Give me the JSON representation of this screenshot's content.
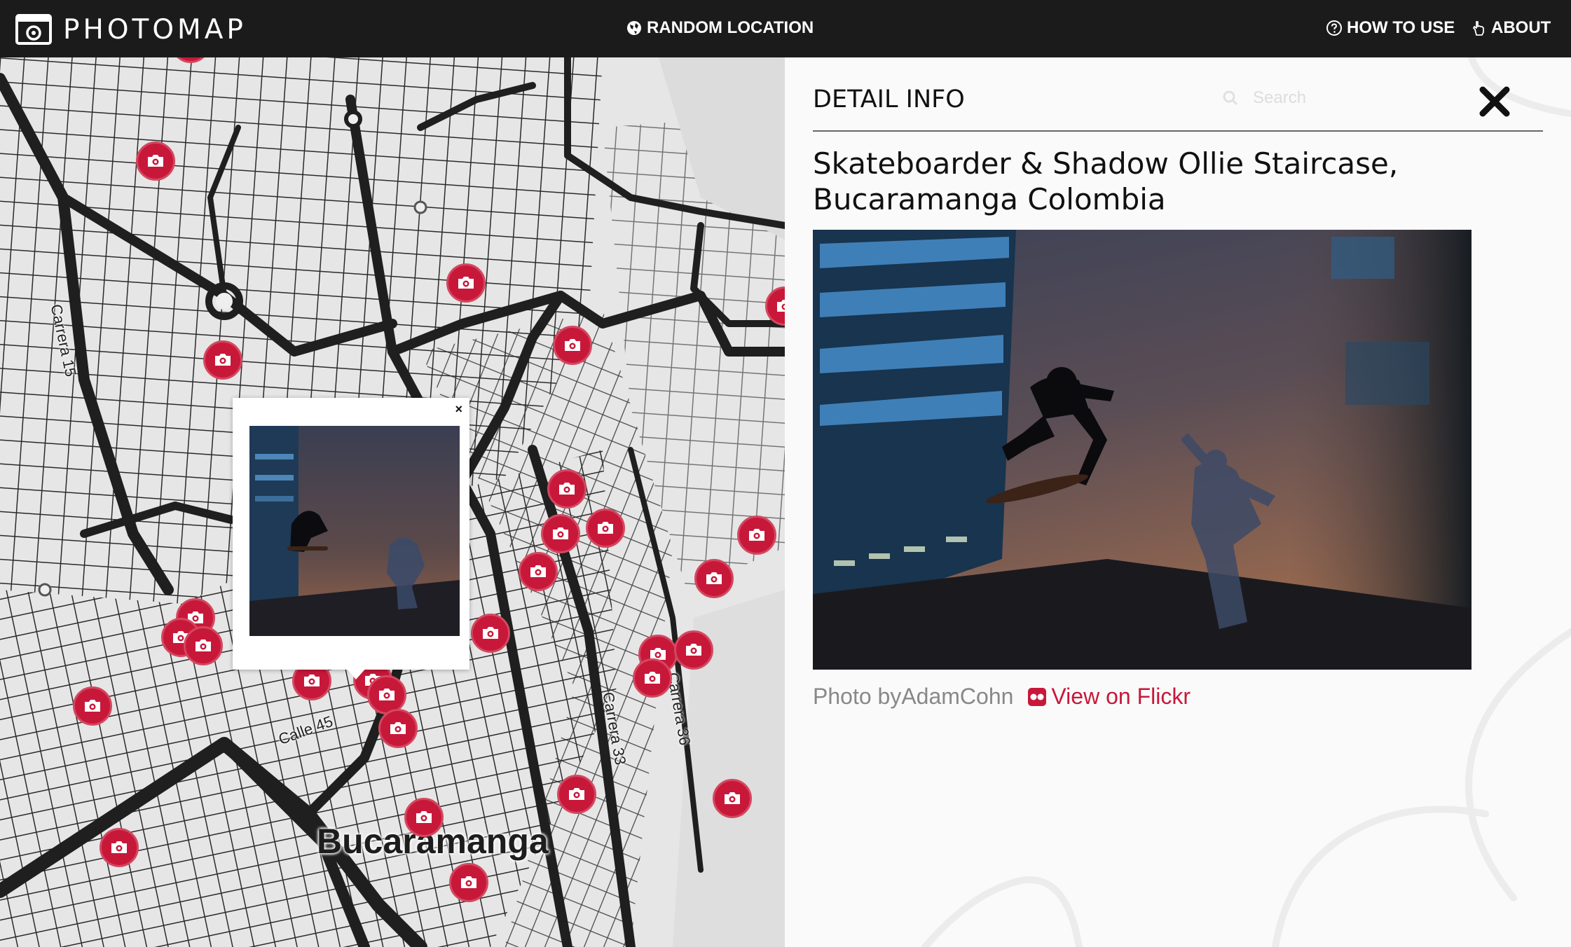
{
  "app": {
    "name": "PHOTOMAP"
  },
  "nav": {
    "random": "RANDOM LOCATION",
    "how_to_use": "HOW TO USE",
    "about": "ABOUT"
  },
  "map": {
    "city_label": "Bucaramanga",
    "street_labels": [
      "Carrera 15",
      "Calle 45",
      "Carrera 33",
      "Carrera 36"
    ]
  },
  "popup": {
    "close_label": "×"
  },
  "panel": {
    "heading": "DETAIL INFO",
    "search_placeholder": "Search",
    "photo_title": "Skateboarder & Shadow Ollie Staircase, Bucaramanga Colombia",
    "credit_prefix": "Photo by",
    "author": "AdamCohn",
    "flickr_link": "View on Flickr"
  },
  "colors": {
    "accent": "#c8183a",
    "topbar": "#1b1b1b"
  }
}
